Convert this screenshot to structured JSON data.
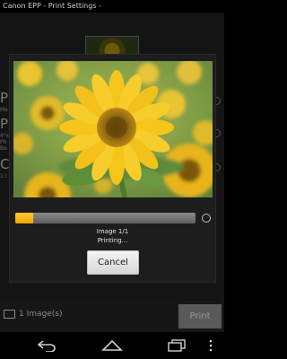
{
  "app": {
    "title": "Canon EPP  - Print Settings -"
  },
  "background": {
    "letters": [
      "P",
      "P",
      "C"
    ],
    "small_lines": [
      "Mx",
      "4\"x",
      "Ph",
      "Bo",
      "1 i"
    ]
  },
  "dialog": {
    "image_label": "Image 1/1",
    "status_label": "Printing...",
    "progress_fraction": 0.1,
    "cancel_label": "Cancel"
  },
  "footer": {
    "image_count_label": "1 Image(s)",
    "print_label": "Print"
  },
  "navbar": {
    "icons": [
      "back-icon",
      "home-icon",
      "recent-apps-icon",
      "menu-icon"
    ]
  },
  "colors": {
    "progress_fill": "#f0a600",
    "progress_track": "#6e6e6e",
    "dialog_bg": "#1d1d1d"
  }
}
